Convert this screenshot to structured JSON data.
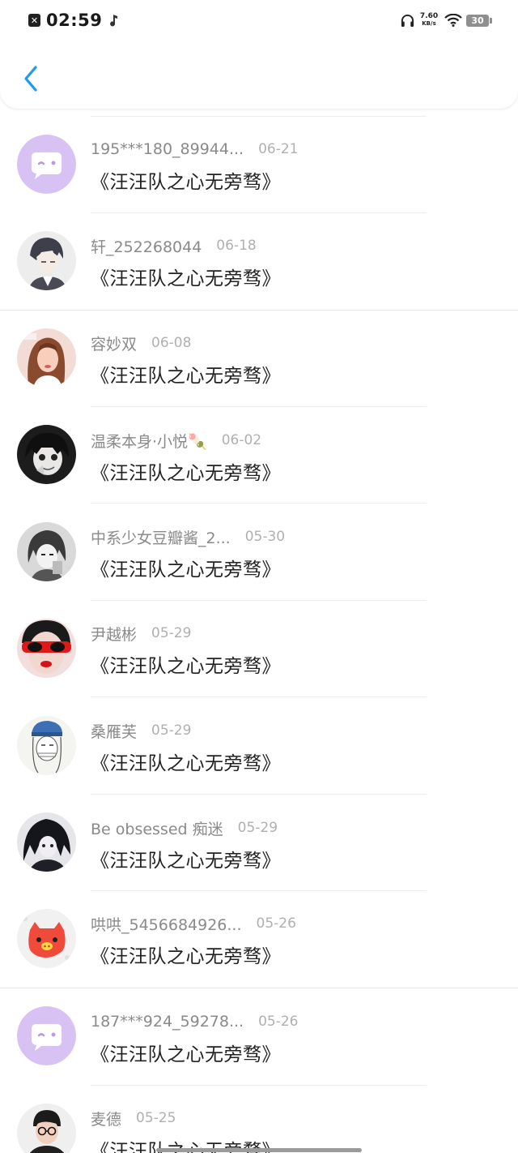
{
  "status_bar": {
    "time": "02:59",
    "net_speed": "7.60",
    "net_unit": "KB/s",
    "battery": "30",
    "app_icon": "close-square-icon",
    "music_icon": "music-note-icon",
    "headphone_icon": "headphone-icon",
    "wifi_icon": "wifi-icon"
  },
  "header": {
    "back_icon": "chevron-left-icon",
    "accent_color": "#1e9bf0"
  },
  "items": [
    {
      "username": "195***180_89944...",
      "date": "06-21",
      "message": "《汪汪队之心无旁骛》",
      "avatar": "default-chat-avatar"
    },
    {
      "username": "轩_252268044",
      "date": "06-18",
      "message": "《汪汪队之心无旁骛》",
      "avatar": "anime-boy-avatar"
    },
    {
      "username": "容妙双",
      "date": "06-08",
      "message": "《汪汪队之心无旁骛》",
      "avatar": "photo-girl-avatar"
    },
    {
      "username": "温柔本身·小悦🍡",
      "date": "06-02",
      "message": "《汪汪队之心无旁骛》",
      "avatar": "anime-girl-dark-avatar"
    },
    {
      "username": "中系少女豆瓣酱_2...",
      "date": "05-30",
      "message": "《汪汪队之心无旁骛》",
      "avatar": "anime-sketch-avatar"
    },
    {
      "username": "尹越彬",
      "date": "05-29",
      "message": "《汪汪队之心无旁骛》",
      "avatar": "red-glasses-avatar"
    },
    {
      "username": "桑雁芙",
      "date": "05-29",
      "message": "《汪汪队之心无旁骛》",
      "avatar": "blue-hat-sketch-avatar"
    },
    {
      "username": "Be obsessed 痴迷",
      "date": "05-29",
      "message": "《汪汪队之心无旁骛》",
      "avatar": "dark-anime-avatar"
    },
    {
      "username": "哄哄_5456684926...",
      "date": "05-26",
      "message": "《汪汪队之心无旁骛》",
      "avatar": "red-pig-avatar"
    },
    {
      "username": "187***924_59278...",
      "date": "05-26",
      "message": "《汪汪队之心无旁骛》",
      "avatar": "default-chat-avatar"
    },
    {
      "username": "麦德",
      "date": "05-25",
      "message": "《汪汪队之心无旁骛》",
      "avatar": "boy-glasses-avatar"
    }
  ]
}
